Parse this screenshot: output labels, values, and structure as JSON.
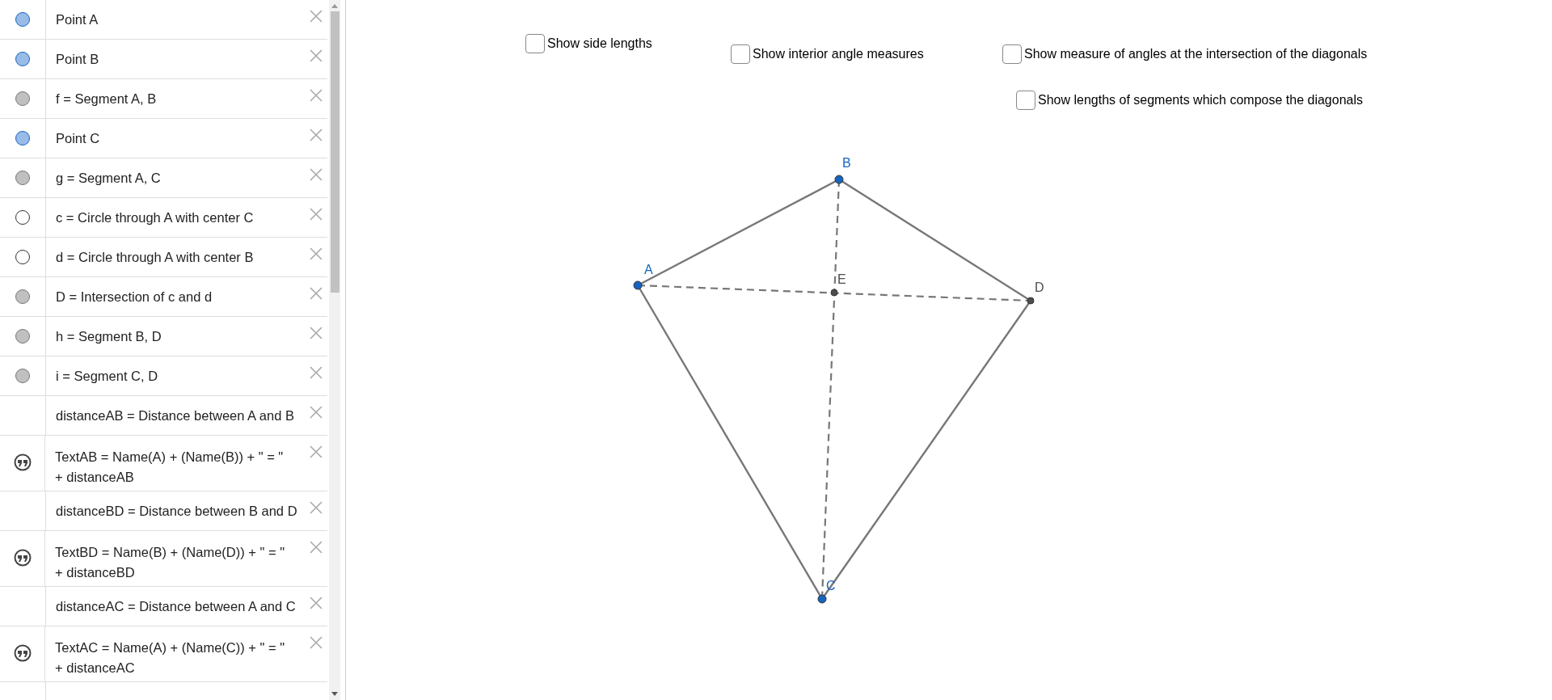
{
  "algebra_view": {
    "items": [
      {
        "kind": "point",
        "lines": [
          "Point A"
        ]
      },
      {
        "kind": "point",
        "lines": [
          "Point B"
        ]
      },
      {
        "kind": "shape",
        "lines": [
          "f = Segment A, B"
        ]
      },
      {
        "kind": "point",
        "lines": [
          "Point C"
        ]
      },
      {
        "kind": "shape",
        "lines": [
          "g = Segment A, C"
        ]
      },
      {
        "kind": "hidden",
        "lines": [
          "c = Circle through A with center C"
        ]
      },
      {
        "kind": "hidden",
        "lines": [
          "d = Circle through A with center B"
        ]
      },
      {
        "kind": "shape",
        "lines": [
          "D = Intersection of c and d"
        ]
      },
      {
        "kind": "shape",
        "lines": [
          "h = Segment B, D"
        ]
      },
      {
        "kind": "shape",
        "lines": [
          "i = Segment C, D"
        ]
      },
      {
        "kind": "none",
        "lines": [
          "distanceAB = Distance between A and B"
        ]
      },
      {
        "kind": "text",
        "lines": [
          "TextAB = Name(A) + (Name(B)) + \" = \"",
          "+ distanceAB"
        ]
      },
      {
        "kind": "none",
        "lines": [
          "distanceBD = Distance between B and D"
        ]
      },
      {
        "kind": "text",
        "lines": [
          "TextBD = Name(B) + (Name(D)) + \" = \"",
          "+ distanceBD"
        ]
      },
      {
        "kind": "none",
        "lines": [
          "distanceAC = Distance between A and C"
        ]
      },
      {
        "kind": "text",
        "lines": [
          "TextAC = Name(A) + (Name(C)) + \" = \"",
          "+ distanceAC"
        ]
      }
    ]
  },
  "checkboxes": [
    {
      "label": "Show side lengths",
      "checked": false
    },
    {
      "label": "Show interior angle measures",
      "checked": false
    },
    {
      "label": "Show measure of angles at the intersection of the diagonals",
      "checked": false
    },
    {
      "label": "Show lengths of segments which compose the diagonals",
      "checked": false
    }
  ],
  "points": [
    {
      "label": "A",
      "color": "#1565c0"
    },
    {
      "label": "B",
      "color": "#1565c0"
    },
    {
      "label": "C",
      "color": "#1565c0"
    },
    {
      "label": "D",
      "color": "#4d4d4d"
    },
    {
      "label": "E",
      "color": "#4d4d4d"
    }
  ]
}
